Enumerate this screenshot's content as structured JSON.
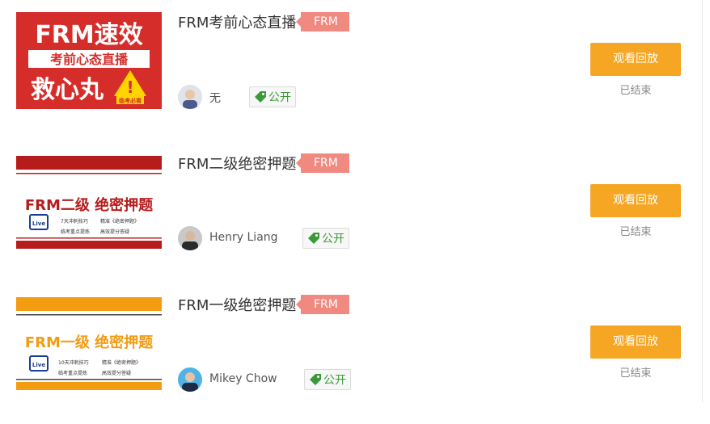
{
  "courses": [
    {
      "title": "FRM考前心态直播",
      "tag": "FRM",
      "teacher": "无",
      "visibility": "公开",
      "button_label": "观看回放",
      "status": "已结束",
      "thumb": {
        "line1": "FRM速效",
        "line2": "考前心态直播",
        "line3": "救心丸",
        "badge": "临考必看"
      }
    },
    {
      "title": "FRM二级绝密押题",
      "tag": "FRM",
      "teacher": "Henry Liang",
      "visibility": "公开",
      "button_label": "观看回放",
      "status": "已结束",
      "thumb": {
        "headline": "FRM二级 绝密押题",
        "tip1a": "7天冲刺技巧",
        "tip1b": "精准《绝密押题》",
        "tip2a": "临考重点提炼",
        "tip2b": "高效提分答疑",
        "live": "Live"
      }
    },
    {
      "title": "FRM一级绝密押题",
      "tag": "FRM",
      "teacher": "Mikey Chow",
      "visibility": "公开",
      "button_label": "观看回放",
      "status": "已结束",
      "thumb": {
        "headline": "FRM一级 绝密押题",
        "tip1a": "10天冲刺技巧",
        "tip1b": "精准《绝密押题》",
        "tip2a": "临考重点提炼",
        "tip2b": "高效提分答疑",
        "live": "Live"
      }
    }
  ],
  "colors": {
    "tag": "#f08a80",
    "button": "#f5a623",
    "public": "#3a9a3a",
    "thumb1_bg": "#d52d2a",
    "thumb2_accent": "#b71c1c",
    "thumb3_accent": "#f39c12"
  }
}
